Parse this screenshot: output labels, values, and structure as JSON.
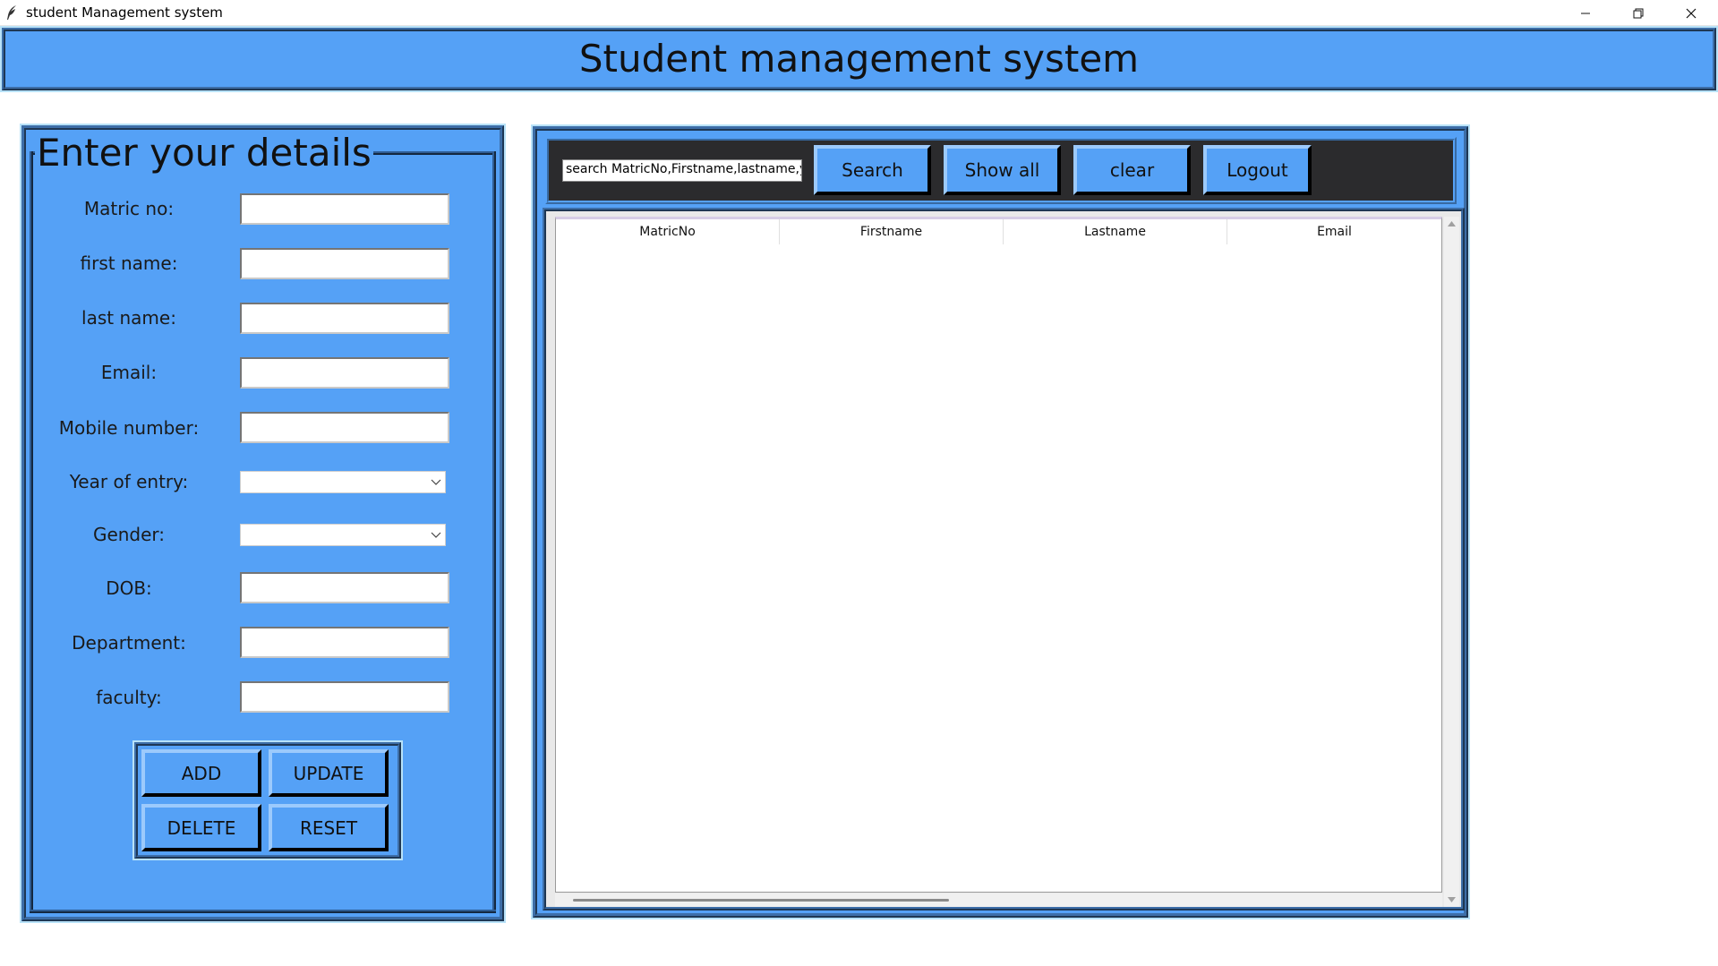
{
  "window": {
    "title": "student Management system"
  },
  "header": {
    "title": "Student management system"
  },
  "form": {
    "legend": "Enter your details",
    "fields": [
      {
        "label": "Matric no:",
        "value": ""
      },
      {
        "label": "first name:",
        "value": ""
      },
      {
        "label": "last name:",
        "value": ""
      },
      {
        "label": "Email:",
        "value": ""
      },
      {
        "label": "Mobile number:",
        "value": ""
      },
      {
        "label": "Year of entry:",
        "value": ""
      },
      {
        "label": "Gender:",
        "value": ""
      },
      {
        "label": "DOB:",
        "value": ""
      },
      {
        "label": "Department:",
        "value": ""
      },
      {
        "label": "faculty:",
        "value": ""
      }
    ],
    "buttons": {
      "add": "ADD",
      "update": "UPDATE",
      "delete": "DELETE",
      "reset": "RESET"
    }
  },
  "toolbar": {
    "search_value": "search MatricNo,Firstname,lastname,yea",
    "search_label": "Search",
    "show_all_label": "Show all",
    "clear_label": "clear",
    "logout_label": "Logout"
  },
  "table": {
    "columns": [
      "MatricNo",
      "Firstname",
      "Lastname",
      "Email"
    ],
    "rows": []
  },
  "colors": {
    "panel": "#55a1f6",
    "toolbar": "#2b2b2d",
    "window_bg": "#ffffff"
  }
}
